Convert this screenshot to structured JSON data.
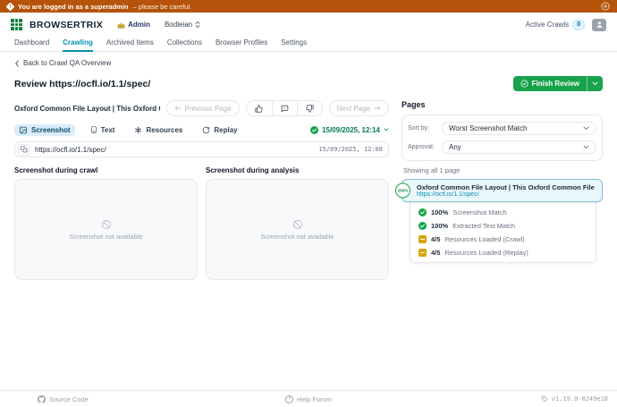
{
  "banner": {
    "message_strong": "You are logged in as a superadmin",
    "message_rest": " – please be careful."
  },
  "header": {
    "brand": "BROWSERTRIX",
    "admin_label": "Admin",
    "org_label": "Bodleian",
    "active_crawls_label": "Active Crawls",
    "active_crawls_count": "0"
  },
  "nav": {
    "items": [
      "Dashboard",
      "Crawling",
      "Archived Items",
      "Collections",
      "Browser Profiles",
      "Settings"
    ]
  },
  "breadcrumb": {
    "back_label": "Back to Crawl QA Overview"
  },
  "review": {
    "title": "Review https://ocfl.io/1.1/spec/",
    "finish_button_label": "Finish Review"
  },
  "pager": {
    "page_title": "Oxford Common File Layout | This Oxford Common File Layo…",
    "previous_label": "Previous Page",
    "next_label": "Next Page"
  },
  "tabs": {
    "items": [
      "Screenshot",
      "Text",
      "Resources",
      "Replay"
    ],
    "active": "Screenshot",
    "timestamp": "15/09/2025, 12:14"
  },
  "urlbar": {
    "url": "https://ocfl.io/1.1/spec/",
    "timestamp": "15/09/2025, 12:08"
  },
  "panels": {
    "crawl_heading": "Screenshot during crawl",
    "analysis_heading": "Screenshot during analysis",
    "placeholder": "Screenshot not available"
  },
  "pages_panel": {
    "title": "Pages",
    "sort_label": "Sort by:",
    "sort_value": "Worst Screenshot Match",
    "approval_label": "Approval:",
    "approval_value": "Any",
    "showing": "Showing all 1 page",
    "card": {
      "badge": "100%",
      "title": "Oxford Common File Layout | This Oxford Common File Layo…",
      "url": "https://ocfl.io/1.1/spec/"
    },
    "stats": [
      {
        "value": "100%",
        "label": "Screenshot Match",
        "status": "success"
      },
      {
        "value": "100%",
        "label": "Extracted Text Match",
        "status": "success"
      },
      {
        "value": "4/5",
        "label": "Resources Loaded (Crawl)",
        "status": "warning"
      },
      {
        "value": "4/5",
        "label": "Resources Loaded (Replay)",
        "status": "warning"
      }
    ]
  },
  "footer": {
    "source_code": "Source Code",
    "help_forum": "Help Forum",
    "version": "v1.19.0-8249e18"
  },
  "colors": {
    "banner_bg": "#b45309",
    "primary": "#0891b2",
    "success": "#18a34b",
    "warning": "#d9a406",
    "brand_text": "#14213d"
  }
}
